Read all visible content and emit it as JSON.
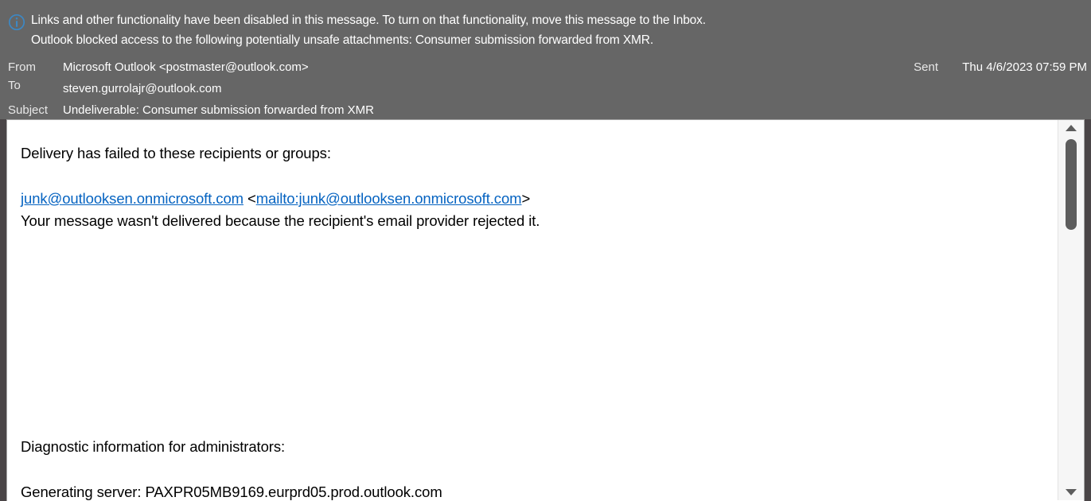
{
  "banner": {
    "icon": "info-circle-icon",
    "line1": "Links and other functionality have been disabled in this message. To turn on that functionality, move this message to the Inbox.",
    "line2": "Outlook blocked access to the following potentially unsafe attachments: Consumer submission forwarded from XMR."
  },
  "header": {
    "from_label": "From",
    "from_value": "Microsoft Outlook <postmaster@outlook.com>",
    "to_label": "To",
    "to_value": "steven.gurrolajr@outlook.com",
    "subject_label": "Subject",
    "subject_value": "Undeliverable: Consumer submission forwarded from XMR",
    "sent_label": "Sent",
    "sent_value": "Thu 4/6/2023 07:59 PM"
  },
  "body": {
    "line1": "Delivery has failed to these recipients or groups:",
    "recipient_link": "junk@outlooksen.onmicrosoft.com",
    "open_angle": " <",
    "mailto_link": "mailto:junk@outlooksen.onmicrosoft.com",
    "close_angle": ">",
    "line3": "Your message wasn't delivered because the recipient's email provider rejected it.",
    "line4": "Diagnostic information for administrators:",
    "line5": "Generating server: PAXPR05MB9169.eurprd05.prod.outlook.com"
  },
  "scrollbar": {
    "up_icon": "scroll-up-arrow-icon",
    "down_icon": "scroll-down-arrow-icon"
  },
  "colors": {
    "header_background": "#666666",
    "body_background": "#ffffff",
    "link": "#0563C1",
    "info_icon": "#3d88c4",
    "scrollbar_thumb": "#5d5d5d"
  }
}
